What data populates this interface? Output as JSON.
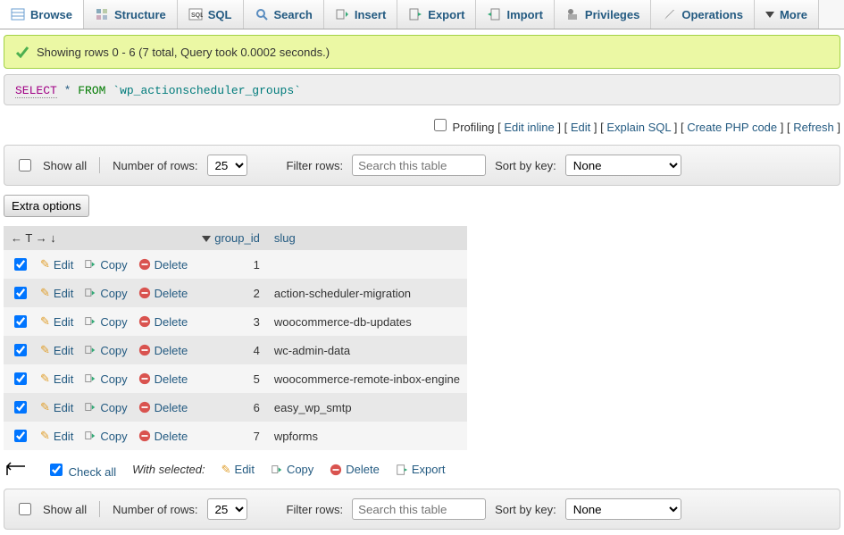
{
  "tabs": [
    {
      "label": "Browse",
      "name": "browse"
    },
    {
      "label": "Structure",
      "name": "structure"
    },
    {
      "label": "SQL",
      "name": "sql"
    },
    {
      "label": "Search",
      "name": "search"
    },
    {
      "label": "Insert",
      "name": "insert"
    },
    {
      "label": "Export",
      "name": "export"
    },
    {
      "label": "Import",
      "name": "import"
    },
    {
      "label": "Privileges",
      "name": "privileges"
    },
    {
      "label": "Operations",
      "name": "operations"
    },
    {
      "label": "More",
      "name": "more"
    }
  ],
  "notice": "Showing rows 0 - 6 (7 total, Query took 0.0002 seconds.)",
  "sql": {
    "kw1": "SELECT",
    "star": "*",
    "kw2": "FROM",
    "table": "`wp_actionscheduler_groups`"
  },
  "profiling": "Profiling",
  "links": {
    "edit_inline": "Edit inline",
    "edit": "Edit",
    "explain": "Explain SQL",
    "php": "Create PHP code",
    "refresh": "Refresh"
  },
  "controls": {
    "show_all": "Show all",
    "num_rows_label": "Number of rows:",
    "num_rows_value": "25",
    "filter_label": "Filter rows:",
    "filter_placeholder": "Search this table",
    "sort_label": "Sort by key:",
    "sort_value": "None"
  },
  "extra_btn": "Extra options",
  "columns": {
    "group_id": "group_id",
    "slug": "slug"
  },
  "row_actions": {
    "edit": "Edit",
    "copy": "Copy",
    "delete": "Delete"
  },
  "rows": [
    {
      "id": "1",
      "slug": ""
    },
    {
      "id": "2",
      "slug": "action-scheduler-migration"
    },
    {
      "id": "3",
      "slug": "woocommerce-db-updates"
    },
    {
      "id": "4",
      "slug": "wc-admin-data"
    },
    {
      "id": "5",
      "slug": "woocommerce-remote-inbox-engine"
    },
    {
      "id": "6",
      "slug": "easy_wp_smtp"
    },
    {
      "id": "7",
      "slug": "wpforms"
    }
  ],
  "checkall": {
    "label": "Check all",
    "with": "With selected:",
    "edit": "Edit",
    "copy": "Copy",
    "delete": "Delete",
    "export": "Export"
  }
}
